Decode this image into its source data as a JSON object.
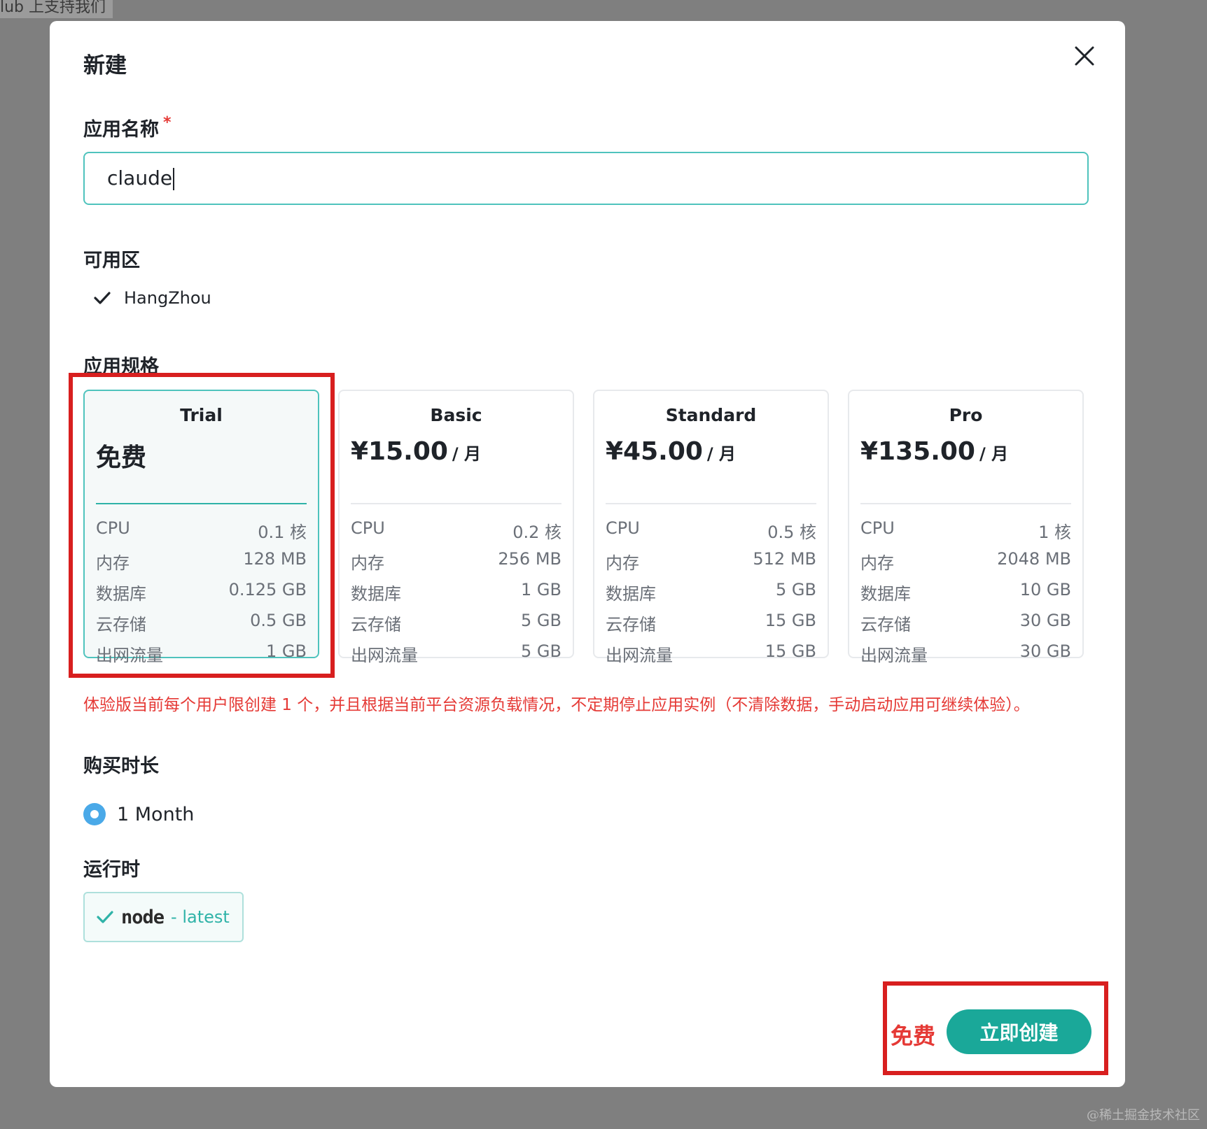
{
  "background": {
    "text": "lub 上支持我们",
    "watermark": "@稀土掘金技术社区"
  },
  "modal": {
    "title": "新建",
    "app_name": {
      "label": "应用名称",
      "required_mark": "*",
      "value": "claude"
    },
    "zone": {
      "label": "可用区",
      "selected": "HangZhou"
    },
    "spec": {
      "label": "应用规格",
      "plans": [
        {
          "name": "Trial",
          "price": "免费",
          "unit": "",
          "selected": true,
          "rows": [
            {
              "k": "CPU",
              "v": "0.1 核"
            },
            {
              "k": "内存",
              "v": "128 MB"
            },
            {
              "k": "数据库",
              "v": "0.125 GB"
            },
            {
              "k": "云存储",
              "v": "0.5 GB"
            },
            {
              "k": "出网流量",
              "v": "1 GB"
            }
          ]
        },
        {
          "name": "Basic",
          "price": "¥15.00",
          "unit": "/ 月",
          "selected": false,
          "rows": [
            {
              "k": "CPU",
              "v": "0.2 核"
            },
            {
              "k": "内存",
              "v": "256 MB"
            },
            {
              "k": "数据库",
              "v": "1 GB"
            },
            {
              "k": "云存储",
              "v": "5 GB"
            },
            {
              "k": "出网流量",
              "v": "5 GB"
            }
          ]
        },
        {
          "name": "Standard",
          "price": "¥45.00",
          "unit": "/ 月",
          "selected": false,
          "rows": [
            {
              "k": "CPU",
              "v": "0.5 核"
            },
            {
              "k": "内存",
              "v": "512 MB"
            },
            {
              "k": "数据库",
              "v": "5 GB"
            },
            {
              "k": "云存储",
              "v": "15 GB"
            },
            {
              "k": "出网流量",
              "v": "15 GB"
            }
          ]
        },
        {
          "name": "Pro",
          "price": "¥135.00",
          "unit": "/ 月",
          "selected": false,
          "rows": [
            {
              "k": "CPU",
              "v": "1 核"
            },
            {
              "k": "内存",
              "v": "2048 MB"
            },
            {
              "k": "数据库",
              "v": "10 GB"
            },
            {
              "k": "云存储",
              "v": "30 GB"
            },
            {
              "k": "出网流量",
              "v": "30 GB"
            }
          ]
        }
      ],
      "warning": "体验版当前每个用户限创建 1 个，并且根据当前平台资源负载情况，不定期停止应用实例（不清除数据，手动启动应用可继续体验）。"
    },
    "duration": {
      "label": "购买时长",
      "option": "1 Month"
    },
    "runtime": {
      "label": "运行时",
      "logo_text": "node",
      "version": "- latest"
    },
    "footer": {
      "price": "免费",
      "create_label": "立即创建"
    }
  },
  "colors": {
    "accent": "#1aa899",
    "highlight_red": "#d81f1f",
    "warning_red": "#e53935",
    "radio_blue": "#4aa9e8"
  },
  "icons": {
    "close": "close-icon",
    "check": "check-icon"
  }
}
